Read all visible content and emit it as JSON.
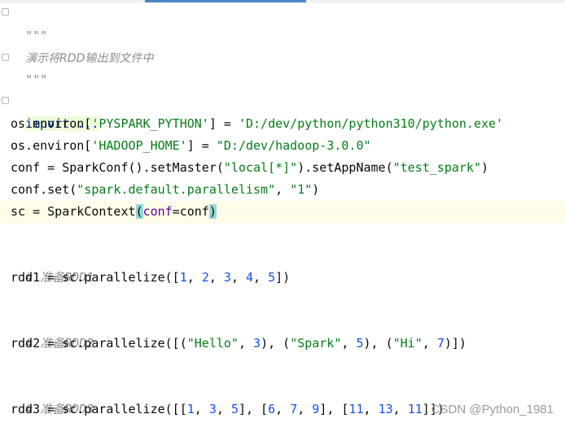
{
  "editor": {
    "docstring_open": "\"\"\"",
    "docstring_text": "演示将RDD输出到文件中",
    "docstring_close": "\"\"\"",
    "import_line": "import ...",
    "env1": {
      "prefix": "os.environ[",
      "key": "'PYSPARK_PYTHON'",
      "mid": "] = ",
      "value": "'D:/dev/python/python310/python.exe'"
    },
    "env2": {
      "prefix": "os.environ[",
      "key": "'HADOOP_HOME'",
      "mid": "] = ",
      "value": "\"D:/dev/hadoop-3.0.0\""
    },
    "conf_line": {
      "a": "conf = SparkConf().setMaster(",
      "s1": "\"local[*]\"",
      "b": ").setAppName(",
      "s2": "\"test_spark\"",
      "c": ")"
    },
    "confset_line": {
      "a": "conf.set(",
      "s1": "\"spark.default.parallelism\"",
      "b": ", ",
      "s2": "\"1\"",
      "c": ")"
    },
    "sc_line": {
      "a": "sc = SparkContext",
      "lp": "(",
      "param": "conf",
      "b": "=conf",
      "rp": ")"
    },
    "comment1": "# 准备RDD1",
    "rdd1": {
      "a": "rdd1 = sc.parallelize([",
      "n1": "1",
      "n2": "2",
      "n3": "3",
      "n4": "4",
      "n5": "5",
      "b": "])"
    },
    "comment2": "# 准备RDD2",
    "rdd2": {
      "a": "rdd2 = sc.parallelize([(",
      "s1": "\"Hello\"",
      "n1": "3",
      "s2": "\"Spark\"",
      "n2": "5",
      "s3": "\"Hi\"",
      "n3": "7",
      "b": ")])"
    },
    "comment3": "# 准备RDD3",
    "rdd3": {
      "a": "rdd3 = sc.parallelize([[",
      "n1": "1",
      "n2": "3",
      "n3": "5",
      "n4": "6",
      "n5": "7",
      "n6": "9",
      "n7": "11",
      "n8": "13",
      "n9": "11",
      "b": "]])"
    }
  },
  "watermark": "CSDN @Python_1981"
}
